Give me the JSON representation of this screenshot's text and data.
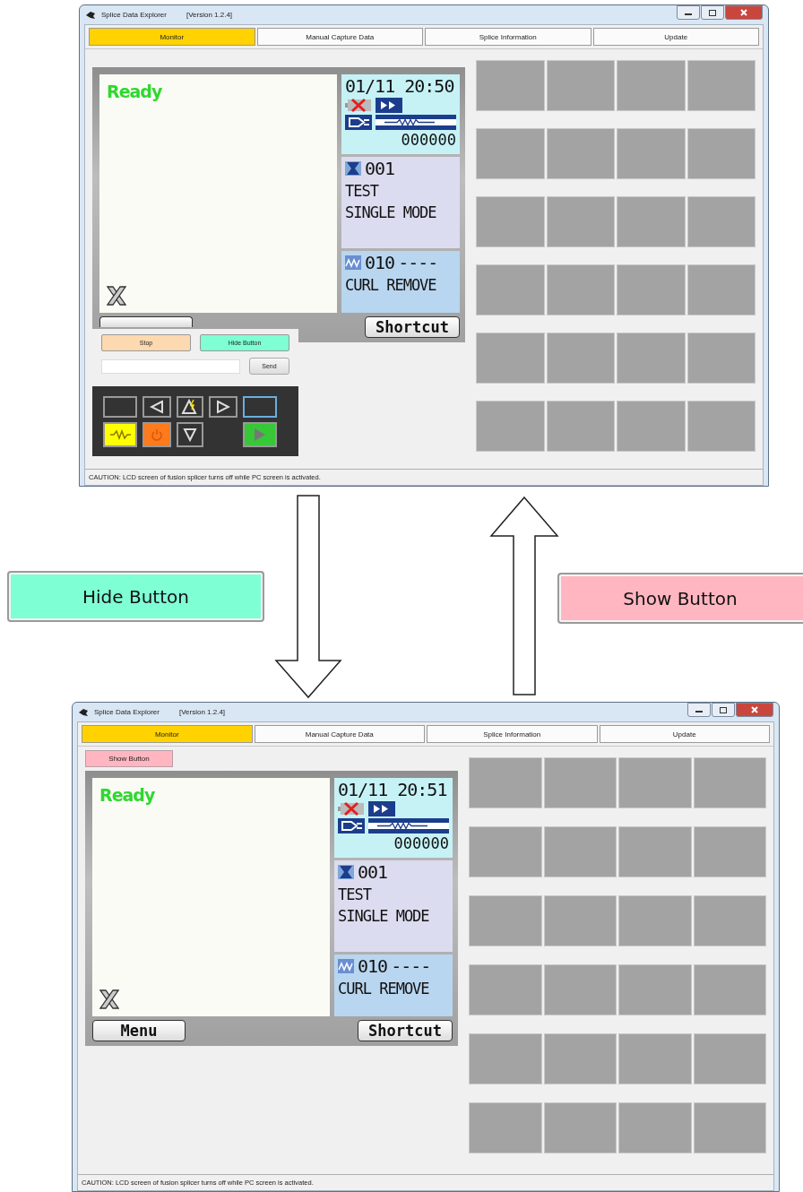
{
  "windows": [
    {
      "title": "Splice Data Explorer",
      "version": "[Version 1.2.4]",
      "tabs": [
        {
          "label": "Monitor",
          "selected": true
        },
        {
          "label": "Manual Capture Data",
          "selected": false
        },
        {
          "label": "Splice Information",
          "selected": false
        },
        {
          "label": "Update",
          "selected": false
        }
      ],
      "lcd": {
        "status": "Ready",
        "datetime": "01/11 20:50",
        "counter": "000000",
        "splice_program": "001",
        "program_name": "TEST",
        "fiber_mode": "SINGLE MODE",
        "heat_program": "010",
        "heat_value": "----",
        "heat_name": "CURL REMOVE",
        "shortcut": "Shortcut"
      },
      "control_panel": {
        "stop": "Stop",
        "hide": "Hide Button",
        "send": "Send"
      },
      "status_bar": "CAUTION: LCD screen of fusion splicer turns off while PC screen is activated."
    },
    {
      "title": "Splice Data Explorer",
      "version": "[Version 1.2.4]",
      "tabs": [
        {
          "label": "Monitor",
          "selected": true
        },
        {
          "label": "Manual Capture Data",
          "selected": false
        },
        {
          "label": "Splice Information",
          "selected": false
        },
        {
          "label": "Update",
          "selected": false
        }
      ],
      "show_button": "Show Button",
      "lcd": {
        "status": "Ready",
        "datetime": "01/11 20:51",
        "counter": "000000",
        "splice_program": "001",
        "program_name": "TEST",
        "fiber_mode": "SINGLE MODE",
        "heat_program": "010",
        "heat_value": "----",
        "heat_name": "CURL REMOVE",
        "menu": "Menu",
        "shortcut": "Shortcut"
      },
      "status_bar": "CAUTION: LCD screen of fusion splicer turns off while PC screen is activated."
    }
  ],
  "callouts": [
    {
      "kind": "hide",
      "label": "Hide Button"
    },
    {
      "kind": "show",
      "label": "Show Button"
    }
  ]
}
